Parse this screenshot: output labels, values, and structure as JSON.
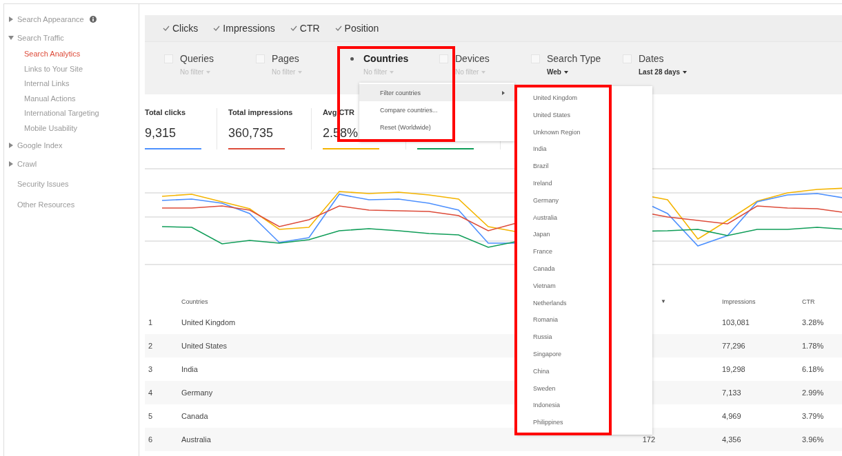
{
  "sidebar": {
    "items": [
      {
        "label": "Search Appearance",
        "kind": "group",
        "expanded": false,
        "info_icon": true
      },
      {
        "label": "Search Traffic",
        "kind": "group",
        "expanded": true,
        "info_icon": false,
        "children": [
          {
            "label": "Search Analytics",
            "selected": true
          },
          {
            "label": "Links to Your Site",
            "selected": false
          },
          {
            "label": "Internal Links",
            "selected": false
          },
          {
            "label": "Manual Actions",
            "selected": false
          },
          {
            "label": "International Targeting",
            "selected": false
          },
          {
            "label": "Mobile Usability",
            "selected": false
          }
        ]
      },
      {
        "label": "Google Index",
        "kind": "group",
        "expanded": false,
        "info_icon": false
      },
      {
        "label": "Crawl",
        "kind": "group",
        "expanded": false,
        "info_icon": false
      },
      {
        "label": "Security Issues",
        "kind": "link",
        "info_icon": false
      },
      {
        "label": "Other Resources",
        "kind": "link",
        "info_icon": false
      }
    ]
  },
  "metric_toggles": [
    {
      "label": "Clicks",
      "checked": true
    },
    {
      "label": "Impressions",
      "checked": true
    },
    {
      "label": "CTR",
      "checked": true
    },
    {
      "label": "Position",
      "checked": true
    }
  ],
  "filters": [
    {
      "label": "Queries",
      "selected": false,
      "kind": "dimension",
      "value": "No filter"
    },
    {
      "label": "Pages",
      "selected": false,
      "kind": "dimension",
      "value": "No filter"
    },
    {
      "label": "Countries",
      "selected": true,
      "kind": "dimension",
      "value": "No filter"
    },
    {
      "label": "Devices",
      "selected": false,
      "kind": "dimension",
      "value": "No filter"
    },
    {
      "label": "Search Type",
      "selected": false,
      "kind": "setting",
      "value": "Web"
    },
    {
      "label": "Dates",
      "selected": false,
      "kind": "setting",
      "value": "Last 28 days"
    }
  ],
  "filter_menu": [
    {
      "label": "Filter countries",
      "selected": true,
      "submenu": true
    },
    {
      "label": "Compare countries...",
      "selected": false,
      "submenu": false
    },
    {
      "label": "Reset (Worldwide)",
      "selected": false,
      "submenu": false
    }
  ],
  "country_menu": [
    "United Kingdom",
    "United States",
    "Unknown Region",
    "India",
    "Brazil",
    "Ireland",
    "Germany",
    "Australia",
    "Japan",
    "France",
    "Canada",
    "Vietnam",
    "Netherlands",
    "Romania",
    "Russia",
    "Singapore",
    "China",
    "Sweden",
    "Indonesia",
    "Philippines"
  ],
  "metrics": [
    {
      "label": "Total clicks",
      "value": "9,315",
      "color": "#4d90fe"
    },
    {
      "label": "Total impressions",
      "value": "360,735",
      "color": "#dd4b39"
    },
    {
      "label": "Avg CTR",
      "value": "2.58%",
      "color": "#f4b400"
    },
    {
      "color": "#0f9d58"
    }
  ],
  "table": {
    "columns": [
      {
        "label": "Countries"
      },
      {
        "label": "▼"
      },
      {
        "label": "Impressions"
      },
      {
        "label": "CTR"
      }
    ],
    "rows": [
      {
        "rank": "1",
        "country": "United Kingdom",
        "impressions": "103,081",
        "ctr": "3.28%"
      },
      {
        "rank": "2",
        "country": "United States",
        "impressions": "77,296",
        "ctr": "1.78%"
      },
      {
        "rank": "3",
        "country": "India",
        "impressions": "19,298",
        "ctr": "6.18%"
      },
      {
        "rank": "4",
        "country": "Germany",
        "impressions": "7,133",
        "ctr": "2.99%"
      },
      {
        "rank": "5",
        "country": "Canada",
        "impressions": "4,969",
        "ctr": "3.79%"
      },
      {
        "rank": "6",
        "country": "Australia",
        "clicks": "172",
        "impressions": "4,356",
        "ctr": "3.96%"
      }
    ]
  }
}
